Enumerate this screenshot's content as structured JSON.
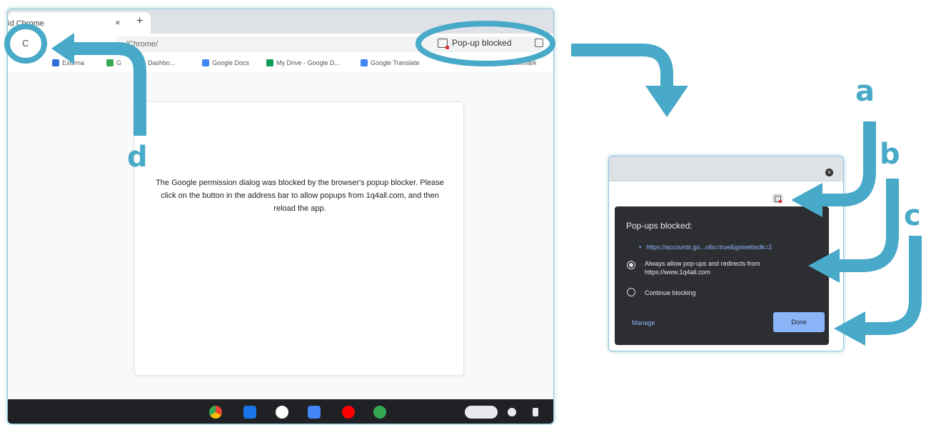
{
  "browser": {
    "tab_title": "id Chrome",
    "tab_close": "×",
    "new_tab": "+",
    "reload_glyph": "C",
    "url_text": "/Chrome/",
    "popup_chip_label": "Pop-up blocked",
    "bookmarks": [
      {
        "label": "Externa",
        "color": "#2f6fd6"
      },
      {
        "label": "G",
        "color": "#34a853"
      },
      {
        "label": "Dashbo...",
        "color": "#fbbc04"
      },
      {
        "label": "Google Docs",
        "color": "#4285f4"
      },
      {
        "label": "My Drive - Google D...",
        "color": "#0f9d58"
      },
      {
        "label": "Google Translate",
        "color": "#4285f4"
      },
      {
        "label": "Bookmark",
        "color": "#9aa0a6"
      }
    ],
    "message": "The Google permission dialog was blocked by the browser's popup blocker. Please click on the button in the address bar to allow popups from 1q4all.com, and then reload the app.",
    "shelf_apps": [
      {
        "name": "chrome-app-icon",
        "color": "#e8453c"
      },
      {
        "name": "files-app-icon",
        "color": "#1a73e8"
      },
      {
        "name": "gmail-app-icon",
        "color": "#ffffff"
      },
      {
        "name": "docs-app-icon",
        "color": "#4285f4"
      },
      {
        "name": "youtube-app-icon",
        "color": "#ff0000"
      },
      {
        "name": "play-store-app-icon",
        "color": "#34a853"
      }
    ]
  },
  "popup_dialog": {
    "close_glyph": "×",
    "title": "Pop-ups blocked:",
    "blocked_link": "https://accounts.go...ollo=true&gsiwebsdk=2",
    "option_allow": "Always allow pop-ups and redirects from https://www.1q4all.com",
    "option_continue": "Continue blocking",
    "manage_label": "Manage",
    "done_label": "Done"
  },
  "annotations": {
    "a": "a",
    "b": "b",
    "c": "c",
    "d": "d",
    "accent_color": "#48a9c8"
  }
}
